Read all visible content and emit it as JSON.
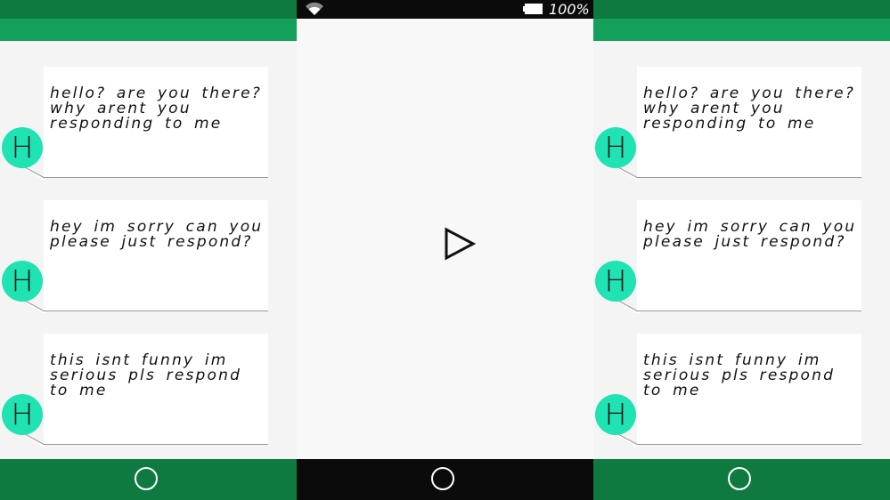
{
  "status_bar": {
    "battery": "100%",
    "wifi_icon": "wifi-icon",
    "battery_icon": "battery-icon"
  },
  "player": {
    "play_icon": "play-icon"
  },
  "messages": [
    {
      "avatar": "H",
      "text": "hello? are you there? why arent you responding to me"
    },
    {
      "avatar": "H",
      "text": "hey im sorry can you please just respond?"
    },
    {
      "avatar": "H",
      "text": "this isnt funny im serious pls respond to me"
    }
  ],
  "colors": {
    "header_dark": "#0e7a40",
    "header_light": "#13a05a",
    "avatar": "#1fe3b3",
    "system_bar": "#0b0b0b"
  }
}
